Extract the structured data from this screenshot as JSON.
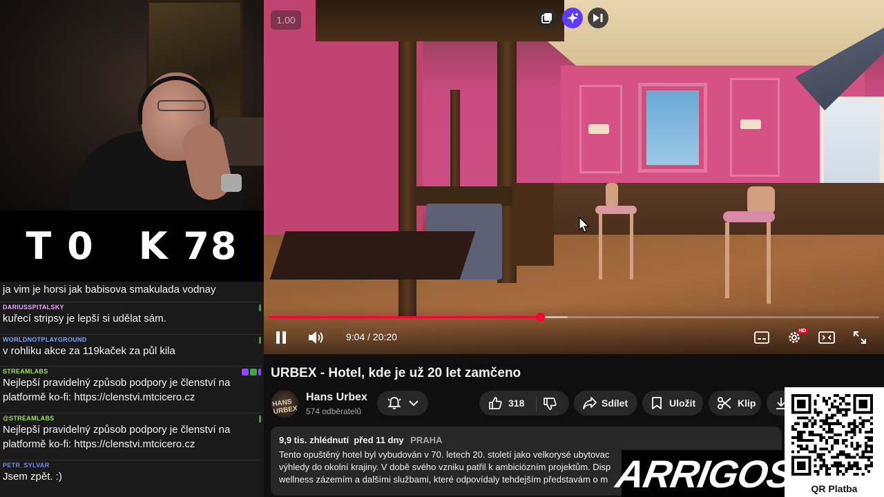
{
  "counter": {
    "left": "T 0",
    "right": "K 78"
  },
  "chat": [
    {
      "author": "",
      "text": "ja vim je horsi jak babisova smakulada vodnay",
      "color": "#ffffff"
    },
    {
      "author": "DARIUSSPITALSKY",
      "text": "kuřecí stripsy je lepší si udělat sám.",
      "color": "#e8a7ff"
    },
    {
      "author": "WORLDNOTPLAYGROUND",
      "text": "v rohliku akce za 119kaček za půl kila",
      "color": "#7aa7ff"
    },
    {
      "author": "STREAMLABS",
      "text1": "Nejlepší pravidelný způsob podpory je členství na",
      "text2": "platformě ko-fi: https://clenstvi.mtcicero.cz",
      "color": "#9be45c"
    },
    {
      "author": "@STREAMLABS",
      "text1": "Nejlepší pravidelný způsob podpory je členství na",
      "text2": "platformě ko-fi: https://clenstvi.mtcicero.cz",
      "color": "#9be45c"
    },
    {
      "author": "PETR_SYLVAR",
      "text": "Jsem zpět. :)",
      "color": "#6a8cff"
    }
  ],
  "player": {
    "speed_badge": "1.00",
    "time": "9:04 / 20:20",
    "progress": 0.445,
    "buffered": 0.49,
    "accent": "#ff0033",
    "icons": [
      "miniplayer-icon",
      "ai-sparkle-icon",
      "skip-icon",
      "pause-icon",
      "volume-icon",
      "subtitles-icon",
      "settings-icon",
      "theater-icon",
      "fullscreen-icon"
    ],
    "quality_badge": "HD"
  },
  "video": {
    "title": "URBEX - Hotel, kde je už 20 let zamčeno",
    "channel": "Hans Urbex",
    "avatar_text": "HANS URBEX",
    "subscribers": "574 odběratelů",
    "likes": "318",
    "share": "Sdílet",
    "save": "Uložit",
    "clip": "Klip"
  },
  "description": {
    "views": "9,9 tis. zhlédnutí",
    "date": "před 11 dny",
    "location": "PRAHA",
    "line1": "Tento opuštěný hotel byl vybudován v 70. letech 20. století jako velkorysé ubytovac",
    "line2": "výhledy do okolní krajiny. V době svého vzniku patřil k ambiciózním projektům. Disp",
    "line3": "wellness zázemím a dalšími službami, které odpovídaly tehdejším představám o m"
  },
  "overlay": {
    "logo": "ARRIGOS",
    "qr_label": "QR Platba"
  }
}
